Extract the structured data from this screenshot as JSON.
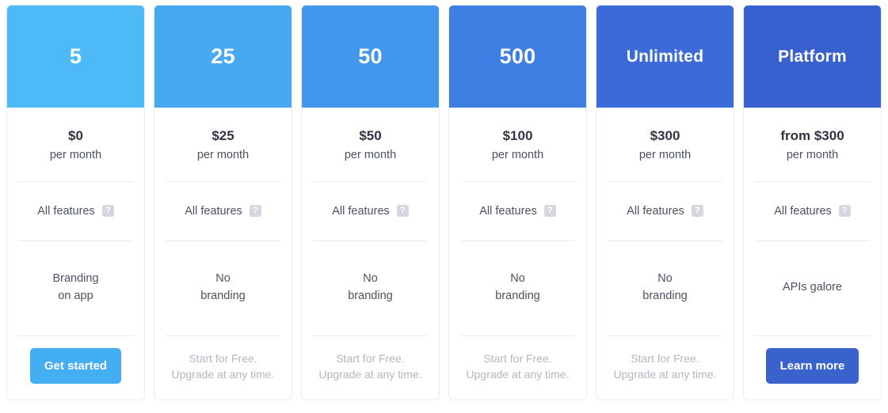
{
  "page": {
    "title": "Pricing plans",
    "colors": {
      "header_1": "#4dbaf7",
      "header_2": "#46a9f2",
      "header_3": "#4296ec",
      "header_4": "#3f7ee3",
      "header_5": "#3b6bd9",
      "header_6": "#3860ce",
      "cta_primary": "#44aef3",
      "cta_platform": "#3a62cc",
      "card_border": "#ececef",
      "divider": "#e9eaee",
      "help_icon_bg": "#d4d8de",
      "text_dark": "#2f3542",
      "text_body": "#4a5260",
      "text_muted": "#b0b7c3"
    }
  },
  "plans": [
    {
      "header": "5",
      "header_is_name": false,
      "header_color": "#4dbaf7",
      "price": "$0",
      "period": "per month",
      "features_label": "All features",
      "help_icon": "question-mark-icon",
      "branding": "Branding\non app",
      "cta_type": "button",
      "cta_label": "Get started",
      "cta_color": "#44aef3"
    },
    {
      "header": "25",
      "header_is_name": false,
      "header_color": "#46a9f2",
      "price": "$25",
      "period": "per month",
      "features_label": "All features",
      "help_icon": "question-mark-icon",
      "branding": "No\nbranding",
      "cta_type": "note",
      "cta_label": "Start for Free.\nUpgrade at any time.",
      "cta_color": ""
    },
    {
      "header": "50",
      "header_is_name": false,
      "header_color": "#4296ec",
      "price": "$50",
      "period": "per month",
      "features_label": "All features",
      "help_icon": "question-mark-icon",
      "branding": "No\nbranding",
      "cta_type": "note",
      "cta_label": "Start for Free.\nUpgrade at any time.",
      "cta_color": ""
    },
    {
      "header": "500",
      "header_is_name": false,
      "header_color": "#3f7ee3",
      "price": "$100",
      "period": "per month",
      "features_label": "All features",
      "help_icon": "question-mark-icon",
      "branding": "No\nbranding",
      "cta_type": "note",
      "cta_label": "Start for Free.\nUpgrade at any time.",
      "cta_color": ""
    },
    {
      "header": "Unlimited",
      "header_is_name": true,
      "header_color": "#3b6bd9",
      "price": "$300",
      "period": "per month",
      "features_label": "All features",
      "help_icon": "question-mark-icon",
      "branding": "No\nbranding",
      "cta_type": "note",
      "cta_label": "Start for Free.\nUpgrade at any time.",
      "cta_color": ""
    },
    {
      "header": "Platform",
      "header_is_name": true,
      "header_color": "#3860ce",
      "price": "from $300",
      "period": "per month",
      "features_label": "All features",
      "help_icon": "question-mark-icon",
      "branding": "APIs galore",
      "cta_type": "button",
      "cta_label": "Learn more",
      "cta_color": "#3a62cc"
    }
  ],
  "help_icon_glyph": "?"
}
